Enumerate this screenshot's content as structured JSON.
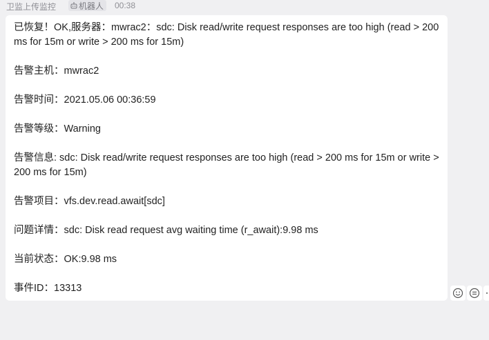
{
  "header": {
    "sender": "卫监上传监控",
    "bot_label": "机器人",
    "time": "00:38"
  },
  "message": {
    "lines": [
      "已恢复！OK,服务器：mwrac2：sdc: Disk read/write request responses are too high (read > 200 ms for 15m or write > 200 ms for 15m)",
      "告警主机：mwrac2",
      "告警时间：2021.05.06 00:36:59",
      "告警等级：Warning",
      "告警信息: sdc: Disk read/write request responses are too high (read > 200 ms for 15m or write > 200 ms for 15m)",
      "告警项目：vfs.dev.read.await[sdc]",
      "问题详情：sdc: Disk read request avg waiting time (r_await):9.98 ms",
      "当前状态：OK:9.98 ms",
      "事件ID：13313"
    ]
  },
  "actions": {
    "icons": [
      "emoji-icon",
      "reply-icon",
      "more-icon"
    ]
  },
  "colors": {
    "background": "#f0f0f2",
    "bubble": "#ffffff",
    "meta_text": "#8f8f95",
    "message_text": "#222222"
  }
}
